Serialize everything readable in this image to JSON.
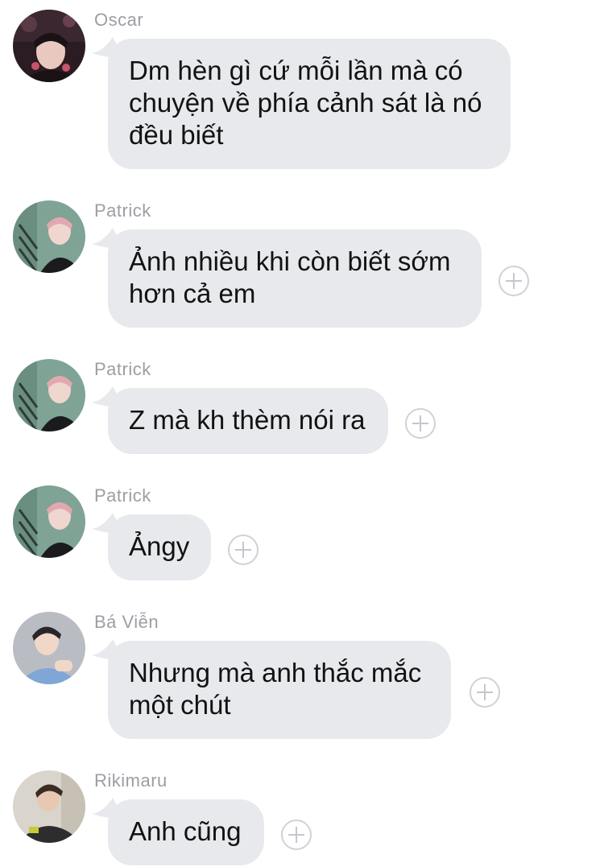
{
  "messages": [
    {
      "sender": "Oscar",
      "text": "Dm hèn gì cứ mỗi lần mà có chuyện về phía cảnh sát là nó đều biết",
      "has_add": false,
      "avatar_colors": {
        "bg": "#2a1c22",
        "skin": "#e9c8c0",
        "hair": "#1a1215",
        "accent": "#c9536b"
      }
    },
    {
      "sender": "Patrick",
      "text": "Ảnh nhiều khi còn biết sớm hơn cả em",
      "has_add": true,
      "avatar_colors": {
        "bg": "#7fa394",
        "skin": "#efd6cf",
        "hair": "#e2a8b0",
        "accent": "#1b1b1e"
      }
    },
    {
      "sender": "Patrick",
      "text": "Z mà kh thèm nói ra",
      "has_add": true,
      "avatar_colors": {
        "bg": "#7fa394",
        "skin": "#efd6cf",
        "hair": "#e2a8b0",
        "accent": "#1b1b1e"
      }
    },
    {
      "sender": "Patrick",
      "text": "Ảngy",
      "has_add": true,
      "avatar_colors": {
        "bg": "#7fa394",
        "skin": "#efd6cf",
        "hair": "#e2a8b0",
        "accent": "#1b1b1e"
      }
    },
    {
      "sender": "Bá Viễn",
      "text": "Nhưng mà anh thắc mắc một chút",
      "has_add": true,
      "avatar_colors": {
        "bg": "#b9bcc3",
        "skin": "#f0d7c8",
        "hair": "#2a2628",
        "accent": "#7fa6d6"
      }
    },
    {
      "sender": "Rikimaru",
      "text": "Anh cũng",
      "has_add": true,
      "avatar_colors": {
        "bg": "#d9d4cc",
        "skin": "#e8c8b0",
        "hair": "#3a2c22",
        "accent": "#2d2d2d"
      }
    }
  ],
  "colors": {
    "bubble": "#e7e9ec",
    "sender_name": "#9b9ea3",
    "message_text": "#121212",
    "add_icon": "#c4c7cc"
  },
  "icons": {
    "add": "plus-circle-icon"
  }
}
